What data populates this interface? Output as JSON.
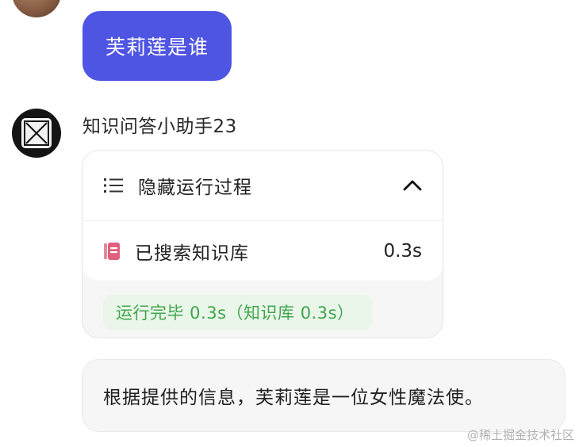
{
  "user_message": {
    "text": "芙莉莲是谁"
  },
  "bot": {
    "name": "知识问答小助手23"
  },
  "process": {
    "toggle_label": "隐藏运行过程",
    "steps": [
      {
        "label": "已搜索知识库",
        "time": "0.3s",
        "icon": "knowledge-base-icon"
      }
    ],
    "status": "运行完毕 0.3s（知识库 0.3s）"
  },
  "answer": {
    "text": "根据提供的信息，芙莉莲是一位女性魔法使。"
  },
  "watermark": "@稀土掘金技术社区",
  "colors": {
    "user_bubble": "#4f55e3",
    "status_text": "#3fa64a",
    "status_bg": "#eaf6ea",
    "kb_icon": "#e0607e"
  }
}
